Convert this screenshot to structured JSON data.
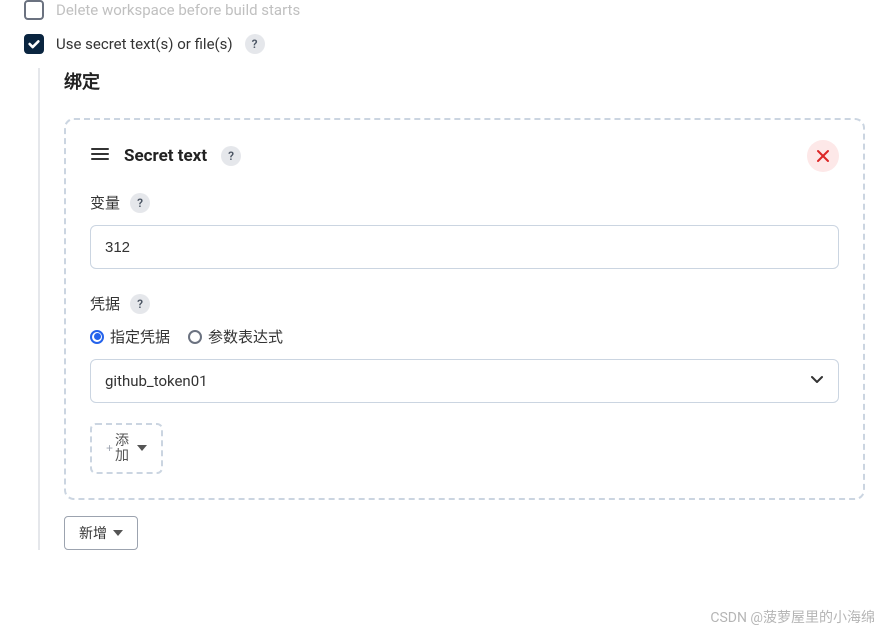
{
  "options": {
    "delete_workspace": {
      "label": "Delete workspace before build starts",
      "checked": false
    },
    "use_secret": {
      "label": "Use secret text(s) or file(s)",
      "checked": true
    }
  },
  "bindings": {
    "title": "绑定",
    "secret_text": {
      "header": "Secret text",
      "variable": {
        "label": "变量",
        "value": "312"
      },
      "credential": {
        "label": "凭据",
        "radio": {
          "specific": "指定凭据",
          "expression": "参数表达式",
          "selected": "specific"
        },
        "selected_value": "github_token01"
      },
      "add_button": "添\n加"
    },
    "new_button": "新增"
  },
  "watermark": "CSDN @菠萝屋里的小海绵"
}
